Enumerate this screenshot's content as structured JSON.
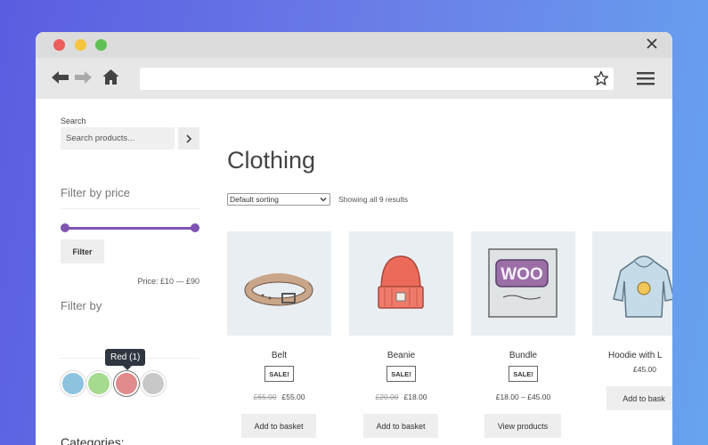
{
  "sidebar": {
    "search_label": "Search",
    "search_placeholder": "Search products...",
    "filter_price_title": "Filter by price",
    "filter_button": "Filter",
    "price_range": "Price: £10 — £90",
    "filter_by_title": "Filter by",
    "swatches": [
      {
        "name": "Blue",
        "color": "#8dc3df"
      },
      {
        "name": "Green",
        "color": "#a6da8f"
      },
      {
        "name": "Red",
        "color": "#e28b8c"
      },
      {
        "name": "Gray",
        "color": "#c8c8c8"
      }
    ],
    "tooltip": "Red (1)",
    "categories_title": "Categories:"
  },
  "main": {
    "title": "Clothing",
    "sort_value": "Default sorting",
    "results_text": "Showing all 9 results",
    "products": [
      {
        "name": "Belt",
        "sale": "SALE!",
        "old_price": "£65.00",
        "price": "£55.00",
        "button": "Add to basket"
      },
      {
        "name": "Beanie",
        "sale": "SALE!",
        "old_price": "£20.00",
        "price": "£18.00",
        "button": "Add to basket"
      },
      {
        "name": "Bundle",
        "sale": "SALE!",
        "old_price": "",
        "price": "£18.00 – £45.00",
        "button": "View products"
      },
      {
        "name": "Hoodie with L",
        "sale": "",
        "old_price": "",
        "price": "£45.00",
        "button": "Add to bask"
      }
    ]
  },
  "colors": {
    "accent": "#7f54b3",
    "thumb_bg": "#e9eef2"
  }
}
